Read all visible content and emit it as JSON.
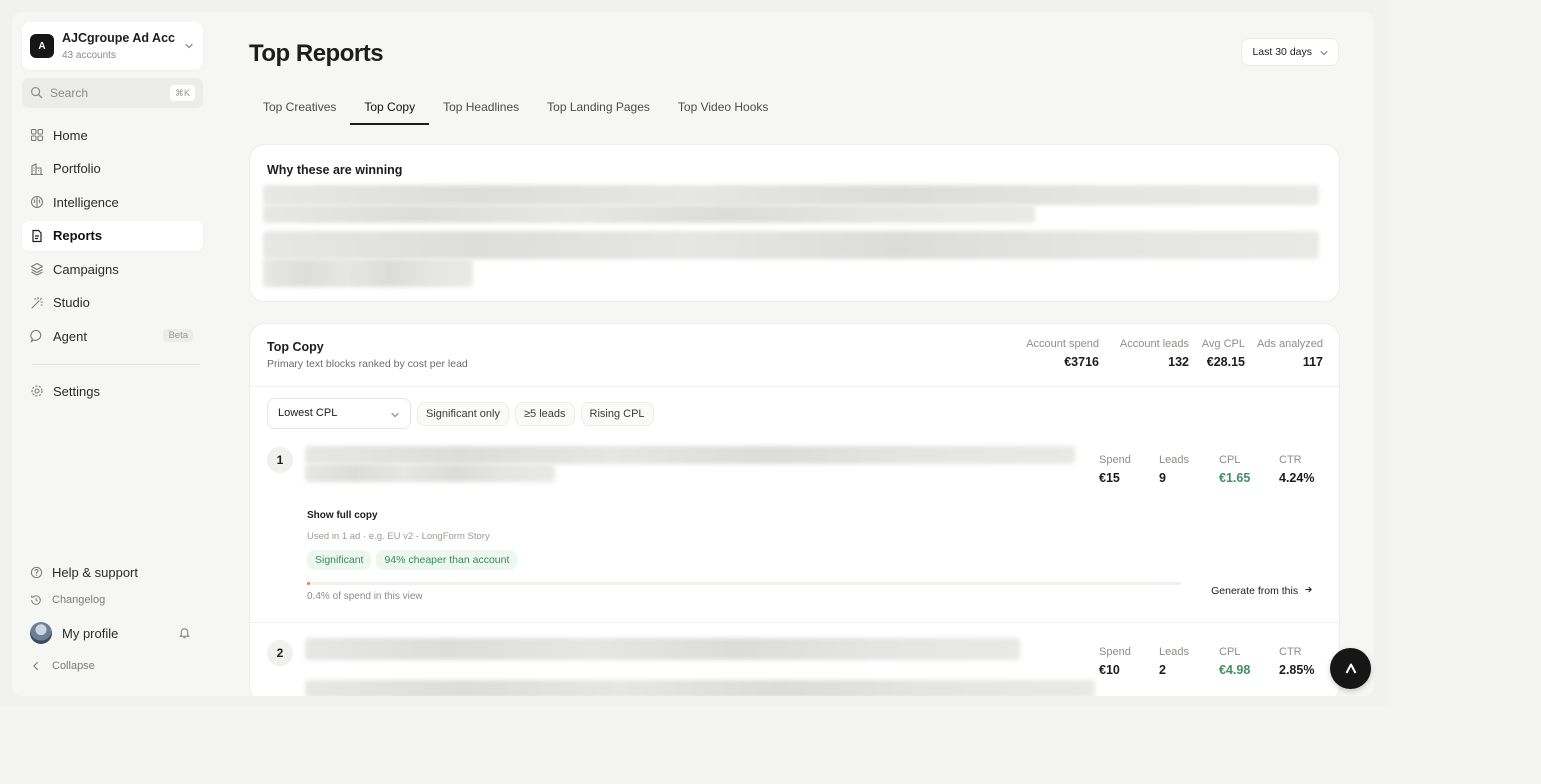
{
  "account": {
    "avatar_letter": "A",
    "name": "AJCgroupe Ad Acc",
    "subtitle": "43 accounts"
  },
  "search": {
    "placeholder": "Search",
    "shortcut": "⌘K"
  },
  "nav": {
    "items": [
      {
        "label": "Home",
        "icon": "grid-icon"
      },
      {
        "label": "Portfolio",
        "icon": "building-icon"
      },
      {
        "label": "Intelligence",
        "icon": "brain-icon"
      },
      {
        "label": "Reports",
        "icon": "document-icon",
        "active": true
      },
      {
        "label": "Campaigns",
        "icon": "layers-icon"
      },
      {
        "label": "Studio",
        "icon": "wand-icon"
      },
      {
        "label": "Agent",
        "icon": "chat-icon",
        "badge": "Beta"
      }
    ],
    "settings": "Settings"
  },
  "bottom": {
    "help": "Help & support",
    "changelog": "Changelog",
    "profile": "My profile",
    "collapse": "Collapse"
  },
  "header": {
    "title": "Top Reports",
    "date_range": "Last 30 days"
  },
  "tabs": [
    "Top Creatives",
    "Top Copy",
    "Top Headlines",
    "Top Landing Pages",
    "Top Video Hooks"
  ],
  "active_tab": "Top Copy",
  "why": {
    "title": "Why these are winning"
  },
  "top_copy": {
    "title": "Top Copy",
    "subtitle": "Primary text blocks ranked by cost per lead",
    "stats": [
      {
        "label": "Account spend",
        "value": "€3716"
      },
      {
        "label": "Account leads",
        "value": "132"
      },
      {
        "label": "Avg CPL",
        "value": "€28.15"
      },
      {
        "label": "Ads analyzed",
        "value": "117"
      }
    ],
    "sort_select": "Lowest CPL",
    "filters": [
      "Significant only",
      "≥5 leads",
      "Rising CPL"
    ],
    "rows": [
      {
        "rank": "1",
        "spend": "€15",
        "leads": "9",
        "cpl": "€1.65",
        "ctr": "4.24%",
        "show_full": "Show full copy",
        "used_in": "Used in 1 ad · e.g. EU v2 - LongForm Story",
        "badges": [
          "Significant",
          "94% cheaper than account"
        ],
        "spend_share": 0.004,
        "spend_share_label": "0.4% of spend in this view",
        "generate": "Generate from this"
      },
      {
        "rank": "2",
        "spend": "€10",
        "leads": "2",
        "cpl": "€4.98",
        "ctr": "2.85%"
      }
    ],
    "metric_labels": {
      "spend": "Spend",
      "leads": "Leads",
      "cpl": "CPL",
      "ctr": "CTR"
    }
  },
  "colors": {
    "accent_green": "#3f8f62",
    "bar_orange": "#e9843b",
    "dark": "#161616"
  }
}
